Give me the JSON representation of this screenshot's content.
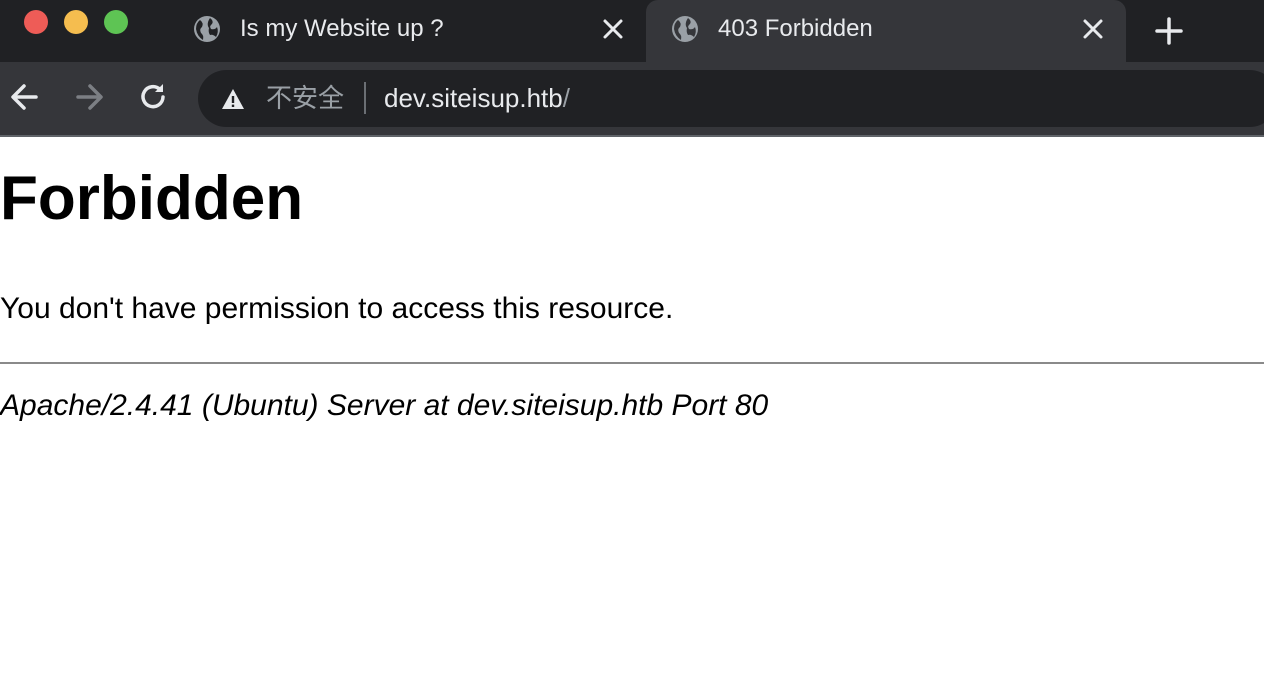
{
  "window": {
    "traffic_lights": {
      "close": "#ee5c57",
      "minimize": "#f5bd4f",
      "zoom": "#5ec454"
    }
  },
  "tabs": [
    {
      "title": "Is my Website up ?",
      "icon": "globe-icon",
      "active": false
    },
    {
      "title": "403 Forbidden",
      "icon": "globe-icon",
      "active": true
    }
  ],
  "toolbar": {
    "security_label": "不安全",
    "url_host": "dev.siteisup.htb",
    "url_path": "/"
  },
  "page": {
    "heading": "Forbidden",
    "message": "You don't have permission to access this resource.",
    "address": "Apache/2.4.41 (Ubuntu) Server at dev.siteisup.htb Port 80"
  },
  "colors": {
    "chrome_dark": "#202124",
    "chrome_tab_active": "#35363a",
    "chrome_text": "#e8eaed",
    "chrome_muted": "#9aa0a6"
  }
}
